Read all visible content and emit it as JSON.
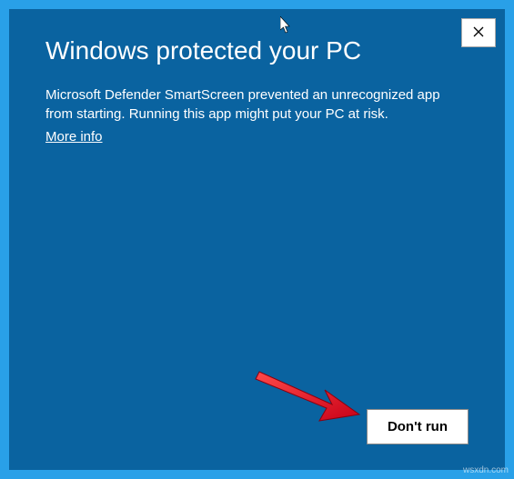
{
  "dialog": {
    "title": "Windows protected your PC",
    "body": "Microsoft Defender SmartScreen prevented an unrecognized app from starting. Running this app might put your PC at risk.",
    "more_info": "More info",
    "dont_run": "Don't run"
  },
  "watermark": "wsxdn.com"
}
